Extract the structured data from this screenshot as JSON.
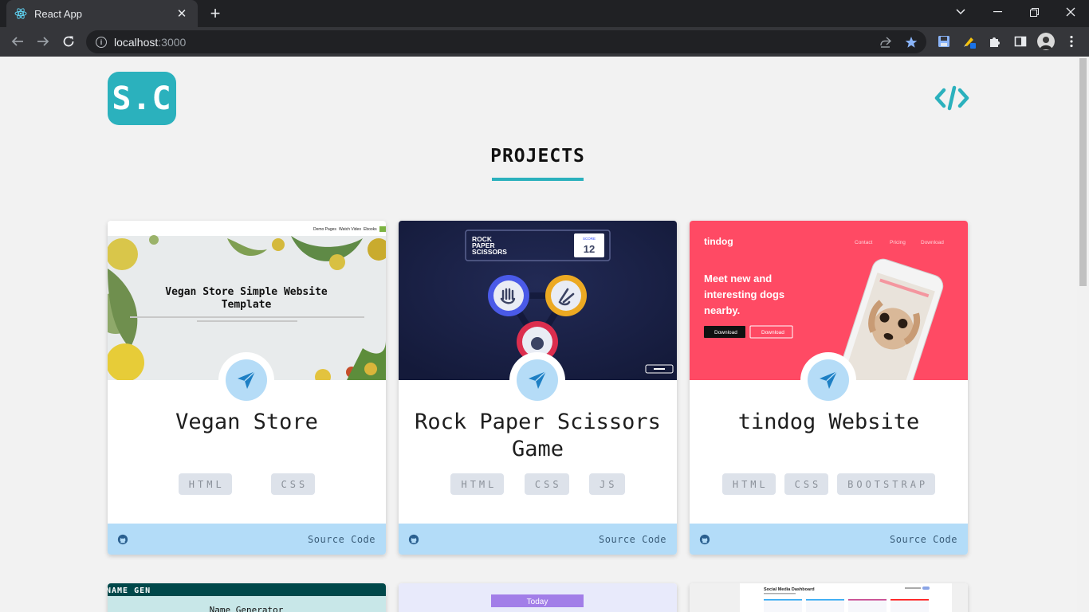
{
  "browser": {
    "tab_title": "React App",
    "url_host": "localhost",
    "url_port": ":3000"
  },
  "header": {
    "logo_text": "S.C"
  },
  "projects": {
    "title": "PROJECTS",
    "cards": [
      {
        "title": "Vegan Store",
        "tags": [
          "HTML",
          "CSS"
        ],
        "source_label": "Source Code",
        "preview": {
          "nav": [
            "Demo Pages",
            "Watch Video",
            "Ebooks"
          ],
          "heading": "Vegan Store Simple Website Template"
        }
      },
      {
        "title": "Rock Paper Scissors Game",
        "tags": [
          "HTML",
          "CSS",
          "JS"
        ],
        "source_label": "Source Code",
        "preview": {
          "logo_lines": [
            "ROCK",
            "PAPER",
            "SCISSORS"
          ],
          "score_label": "SCORE",
          "score_value": "12"
        }
      },
      {
        "title": "tindog Website",
        "tags": [
          "HTML",
          "CSS",
          "BOOTSTRAP"
        ],
        "source_label": "Source Code",
        "preview": {
          "brand": "tindog",
          "nav": [
            "Contact",
            "Pricing",
            "Download"
          ],
          "headline": "Meet new and interesting dogs nearby.",
          "btn_a": "Download",
          "btn_b": "Download"
        }
      }
    ],
    "partial_cards": [
      {
        "header": "NAME GEN",
        "subtitle": "Name Generator"
      },
      {
        "pill": "Today"
      },
      {
        "heading": "Social Media Dashboard"
      }
    ]
  },
  "colors": {
    "accent": "#2bb1bd",
    "footer": "#b3dcf8",
    "tindog_bg": "#ff4a64",
    "rps_bg": "#1c2348"
  }
}
